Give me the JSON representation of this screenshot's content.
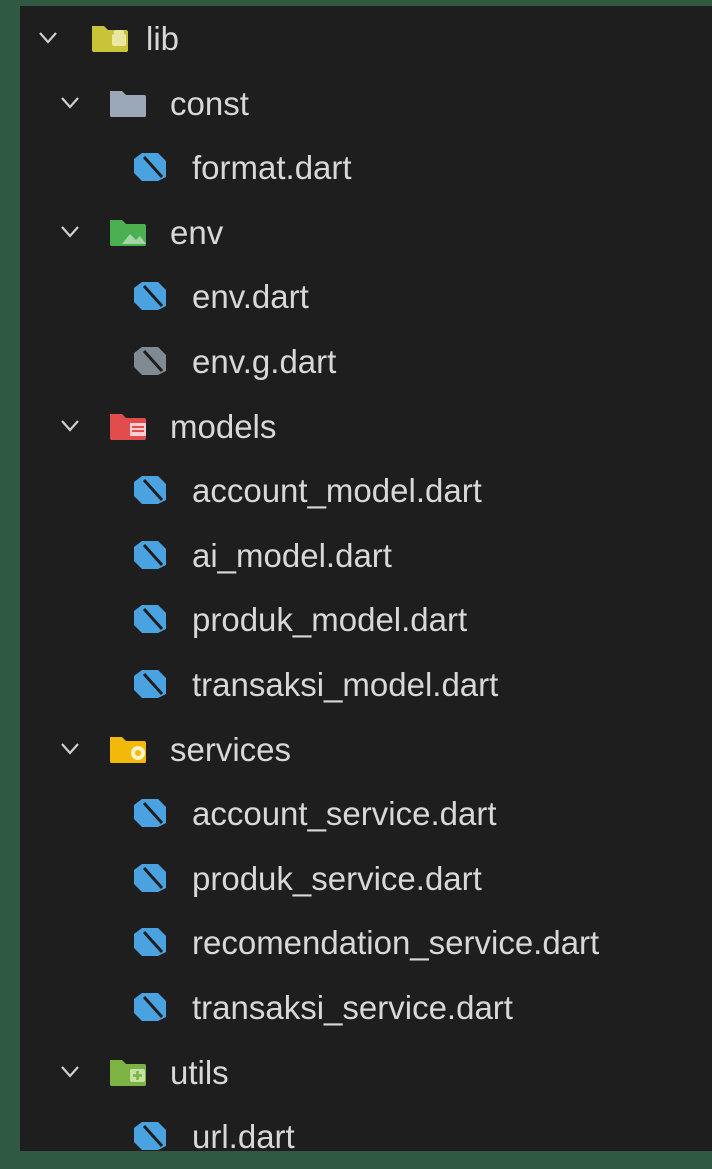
{
  "explorer": {
    "items": [
      {
        "label": "lib",
        "kind": "folder",
        "depth": 0,
        "icon": "folder-lib-icon",
        "color": "#c7c43a"
      },
      {
        "label": "const",
        "kind": "folder",
        "depth": 1,
        "icon": "folder-const-icon",
        "color": "#9aa8b8"
      },
      {
        "label": "format.dart",
        "kind": "file",
        "depth": 2,
        "icon": "dart-file-icon",
        "color": "#4aa3e0"
      },
      {
        "label": "env",
        "kind": "folder",
        "depth": 1,
        "icon": "folder-env-icon",
        "color": "#4caf50"
      },
      {
        "label": "env.dart",
        "kind": "file",
        "depth": 2,
        "icon": "dart-file-icon",
        "color": "#4aa3e0"
      },
      {
        "label": "env.g.dart",
        "kind": "file",
        "depth": 2,
        "icon": "dart-generated-file-icon",
        "color": "#7f8a93"
      },
      {
        "label": "models",
        "kind": "folder",
        "depth": 1,
        "icon": "folder-models-icon",
        "color": "#e24c4c"
      },
      {
        "label": "account_model.dart",
        "kind": "file",
        "depth": 2,
        "icon": "dart-file-icon",
        "color": "#4aa3e0"
      },
      {
        "label": "ai_model.dart",
        "kind": "file",
        "depth": 2,
        "icon": "dart-file-icon",
        "color": "#4aa3e0"
      },
      {
        "label": "produk_model.dart",
        "kind": "file",
        "depth": 2,
        "icon": "dart-file-icon",
        "color": "#4aa3e0"
      },
      {
        "label": "transaksi_model.dart",
        "kind": "file",
        "depth": 2,
        "icon": "dart-file-icon",
        "color": "#4aa3e0"
      },
      {
        "label": "services",
        "kind": "folder",
        "depth": 1,
        "icon": "folder-services-icon",
        "color": "#f2b80c"
      },
      {
        "label": "account_service.dart",
        "kind": "file",
        "depth": 2,
        "icon": "dart-file-icon",
        "color": "#4aa3e0"
      },
      {
        "label": "produk_service.dart",
        "kind": "file",
        "depth": 2,
        "icon": "dart-file-icon",
        "color": "#4aa3e0"
      },
      {
        "label": "recomendation_service.dart",
        "kind": "file",
        "depth": 2,
        "icon": "dart-file-icon",
        "color": "#4aa3e0"
      },
      {
        "label": "transaksi_service.dart",
        "kind": "file",
        "depth": 2,
        "icon": "dart-file-icon",
        "color": "#4aa3e0"
      },
      {
        "label": "utils",
        "kind": "folder",
        "depth": 1,
        "icon": "folder-utils-icon",
        "color": "#7cb342"
      },
      {
        "label": "url.dart",
        "kind": "file",
        "depth": 2,
        "icon": "dart-file-icon",
        "color": "#4aa3e0"
      }
    ]
  }
}
